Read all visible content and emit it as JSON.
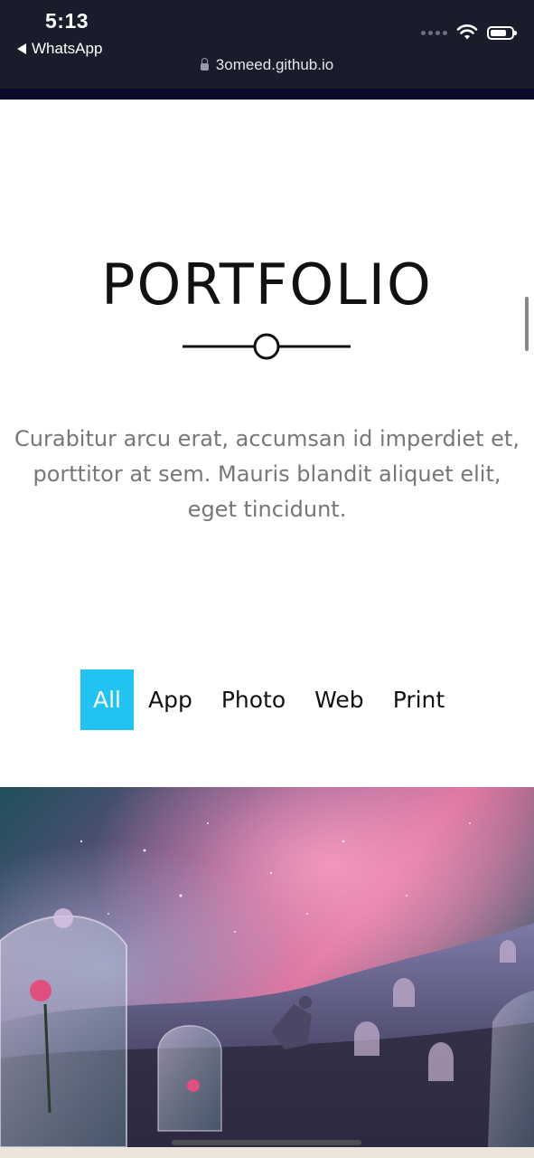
{
  "status_bar": {
    "time": "5:13",
    "back_label": "WhatsApp",
    "url": "3omeed.github.io"
  },
  "section": {
    "title": "PORTFOLIO",
    "description": "Curabitur arcu erat, accumsan id imperdiet et, porttitor at sem. Mauris blandit aliquet elit, eget tincidunt."
  },
  "filters": [
    {
      "label": "All",
      "active": true
    },
    {
      "label": "App",
      "active": false
    },
    {
      "label": "Photo",
      "active": false
    },
    {
      "label": "Web",
      "active": false
    },
    {
      "label": "Print",
      "active": false
    }
  ],
  "colors": {
    "accent": "#22c3f0",
    "status_bar_bg": "#1b1c2b",
    "description_text": "#777777"
  }
}
